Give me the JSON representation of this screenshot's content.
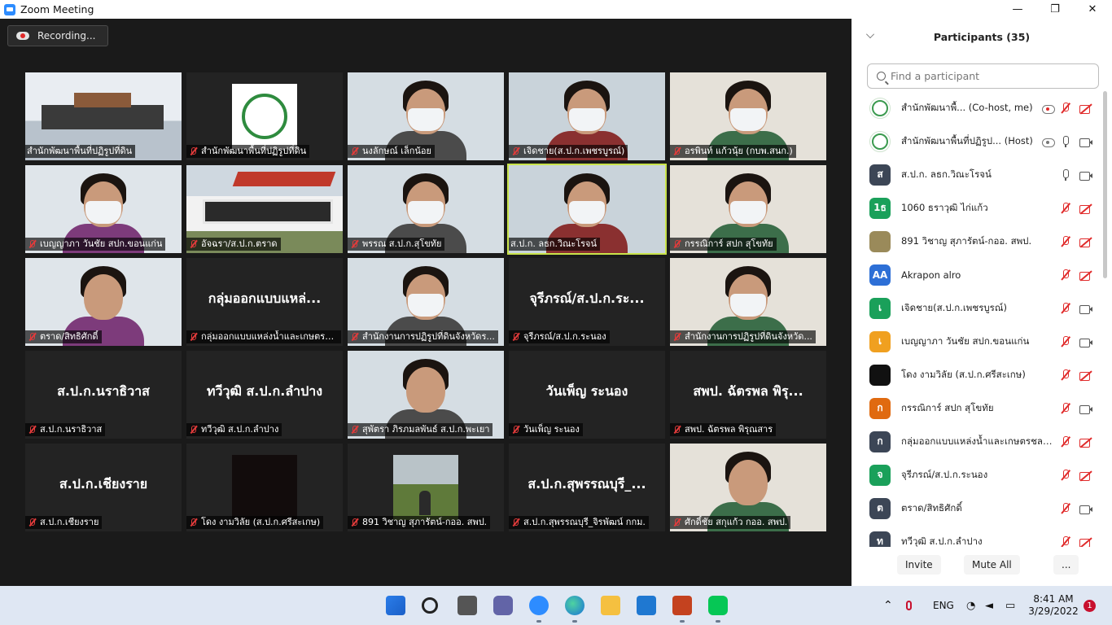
{
  "window": {
    "title": "Zoom Meeting"
  },
  "recording": {
    "label": "Recording..."
  },
  "gallery": {
    "tiles": [
      {
        "name": "สำนักพัฒนาพื้นที่ปฏิรูปที่ดิน",
        "muted": false,
        "video": "room"
      },
      {
        "name": "สำนักพัฒนาพื้นที่ปฏิรูปที่ดิน",
        "muted": true,
        "video": "logo"
      },
      {
        "name": "นงลักษณ์ เล็กน้อย",
        "muted": true,
        "video": "person-mask"
      },
      {
        "name": "เจิดชาย(ส.ป.ก.เพชรบูรณ์)",
        "muted": true,
        "video": "person-mask"
      },
      {
        "name": "อรพินท์ แก้วนุ้ย (กบพ.สนก.)",
        "muted": true,
        "video": "person-mask"
      },
      {
        "name": "เบญญาภา วันชัย สปก.ขอนแก่น",
        "muted": true,
        "video": "person-mask"
      },
      {
        "name": "อัจฉรา/ส.ป.ก.ตราด",
        "muted": true,
        "video": "sign"
      },
      {
        "name": "พรรณ ส.ป.ก.สุโขทัย",
        "muted": true,
        "video": "person-mask"
      },
      {
        "name": "ส.ป.ก. ลธก.วิณะโรจน์",
        "muted": false,
        "video": "person-mask",
        "active": true
      },
      {
        "name": "กรรณิการ์ สปก สุโขทัย",
        "muted": true,
        "video": "person-mask"
      },
      {
        "name": "ตราด/สิทธิศักดิ์",
        "muted": true,
        "video": "person"
      },
      {
        "name": "กลุ่มออกแบบแหล่งน้ำและเกษตรช...",
        "muted": true,
        "video": "none",
        "big": "กลุ่มออกแบบแหล่..."
      },
      {
        "name": "สำนักงานการปฏิรูปที่ดินจังหวัดร...",
        "muted": true,
        "video": "person-mask"
      },
      {
        "name": "จุรีภรณ์/ส.ป.ก.ระนอง",
        "muted": true,
        "video": "none",
        "big": "จุรีภรณ์/ส.ป.ก.ระ..."
      },
      {
        "name": "สำนักงานการปฏิรูปที่ดินจังหวัด...",
        "muted": true,
        "video": "person-mask"
      },
      {
        "name": "ส.ป.ก.นราธิวาส",
        "muted": true,
        "video": "none",
        "big": "ส.ป.ก.นราธิวาส"
      },
      {
        "name": "ทวีวุฒิ ส.ป.ก.ลำปาง",
        "muted": true,
        "video": "none",
        "big": "ทวีวุฒิ ส.ป.ก.ลำปาง"
      },
      {
        "name": "สุพัตรา ภิรภมลพันธ์ ส.ป.ก.พะเยา",
        "muted": true,
        "video": "person"
      },
      {
        "name": "วันเพ็ญ ระนอง",
        "muted": true,
        "video": "none",
        "big": "วันเพ็ญ ระนอง"
      },
      {
        "name": "สพป. ฉัตรพล พิรุณสาร",
        "muted": true,
        "video": "none",
        "big": "สพป. ฉัตรพล พิรุ..."
      },
      {
        "name": "ส.ป.ก.เชียงราย",
        "muted": true,
        "video": "none",
        "big": "ส.ป.ก.เชียงราย"
      },
      {
        "name": "โดง งามวิลัย (ส.ป.ก.ศรีสะเกษ)",
        "muted": true,
        "video": "dark"
      },
      {
        "name": "891 วิชาญ  สุภารัตน์-กออ. สพป.",
        "muted": true,
        "video": "outdoor"
      },
      {
        "name": "ส.ป.ก.สุพรรณบุรี_จิรพัฒน์ กกม.",
        "muted": true,
        "video": "none",
        "big": "ส.ป.ก.สุพรรณบุรี_..."
      },
      {
        "name": "ศักดิ์ชัย สกุแก้ว กออ. สพป.",
        "muted": true,
        "video": "person"
      }
    ]
  },
  "participants": {
    "title": "Participants (35)",
    "search_placeholder": "Find a participant",
    "list": [
      {
        "name": "สำนักพัฒนาพื้...",
        "role": "(Co-host, me)",
        "avatar_text": "",
        "avatar_color": "#ffffff",
        "logo": true,
        "mic": "off",
        "cam": "off",
        "rec": true
      },
      {
        "name": "สำนักพัฒนาพื้นที่ปฏิรูป...",
        "role": "(Host)",
        "avatar_text": "",
        "avatar_color": "#ffffff",
        "logo": true,
        "mic": "on",
        "cam": "on",
        "rec": true
      },
      {
        "name": "ส.ป.ก. ลธก.วิณะโรจน์",
        "role": "",
        "avatar_text": "ส",
        "avatar_color": "#3c4656",
        "mic": "on",
        "cam": "on"
      },
      {
        "name": "1060 ธราวุฒิ ไก่แก้ว",
        "role": "",
        "avatar_text": "1ธ",
        "avatar_color": "#1aa05a",
        "mic": "off",
        "cam": "off"
      },
      {
        "name": "891 วิชาญ  สุภารัตน์-กออ. สพป.",
        "role": "",
        "avatar_text": "",
        "avatar_color": "#9a8a5a",
        "mic": "off",
        "cam": "off"
      },
      {
        "name": "Akrapon alro",
        "role": "",
        "avatar_text": "AA",
        "avatar_color": "#2d6fd6",
        "mic": "off",
        "cam": "off"
      },
      {
        "name": "เจิดชาย(ส.ป.ก.เพชรบูรณ์)",
        "role": "",
        "avatar_text": "เ",
        "avatar_color": "#1aa05a",
        "mic": "off",
        "cam": "on"
      },
      {
        "name": "เบญญาภา วันชัย สปก.ขอนแก่น",
        "role": "",
        "avatar_text": "เ",
        "avatar_color": "#f0a020",
        "mic": "off",
        "cam": "on"
      },
      {
        "name": "โดง งามวิลัย (ส.ป.ก.ศรีสะเกษ)",
        "role": "",
        "avatar_text": "",
        "avatar_color": "#111111",
        "mic": "off",
        "cam": "off"
      },
      {
        "name": "กรรณิการ์ สปก สุโขทัย",
        "role": "",
        "avatar_text": "ก",
        "avatar_color": "#e06a10",
        "mic": "off",
        "cam": "on"
      },
      {
        "name": "กลุ่มออกแบบแหล่งน้ำและเกษตรชลประ...",
        "role": "",
        "avatar_text": "ก",
        "avatar_color": "#3c4656",
        "mic": "off",
        "cam": "off"
      },
      {
        "name": "จุรีภรณ์/ส.ป.ก.ระนอง",
        "role": "",
        "avatar_text": "จ",
        "avatar_color": "#1aa05a",
        "mic": "off",
        "cam": "off"
      },
      {
        "name": "ตราด/สิทธิศักดิ์",
        "role": "",
        "avatar_text": "ต",
        "avatar_color": "#3c4656",
        "mic": "off",
        "cam": "on"
      },
      {
        "name": "ทวีวุฒิ ส.ป.ก.ลำปาง",
        "role": "",
        "avatar_text": "ท",
        "avatar_color": "#3c4656",
        "mic": "off",
        "cam": "off"
      }
    ],
    "buttons": {
      "invite": "Invite",
      "mute_all": "Mute All",
      "more": "..."
    }
  },
  "taskbar": {
    "language": "ENG",
    "time": "8:41 AM",
    "date": "3/29/2022",
    "notifications": "1"
  }
}
